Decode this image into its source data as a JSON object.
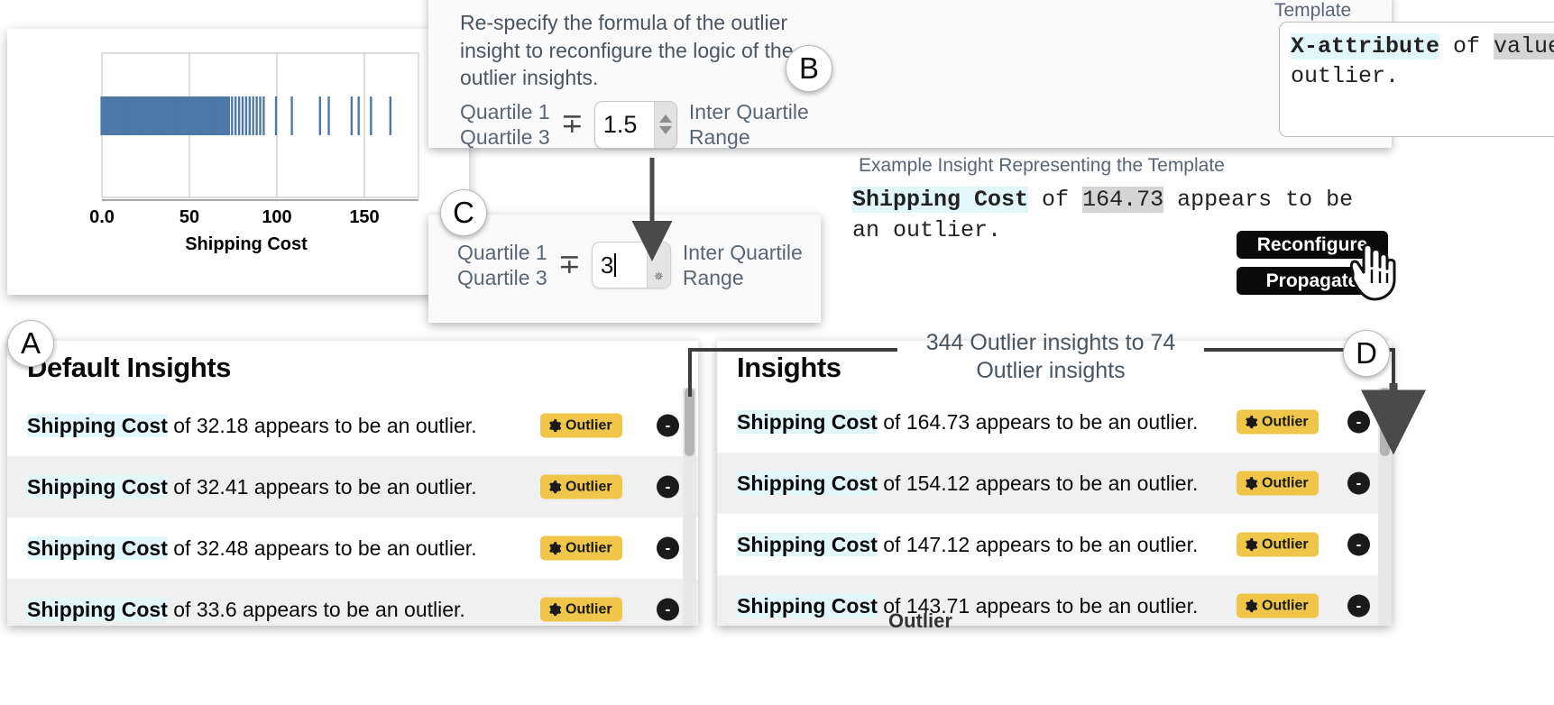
{
  "chart_panel": {
    "x_label": "Shipping Cost",
    "x_ticks": [
      "0.0",
      "50",
      "100",
      "150"
    ],
    "bar_color": "#4d79a8"
  },
  "chart_data": {
    "type": "scatter",
    "title": "",
    "xlabel": "Shipping Cost",
    "ylabel": "",
    "xlim": [
      -10,
      180
    ],
    "x_ticks": [
      0,
      50,
      100,
      150
    ],
    "x_tick_labels": [
      "0.0",
      "50",
      "100",
      "150"
    ],
    "grid": true,
    "legend": null,
    "description": "One-dimensional strip / rug plot of Shipping Cost values; dense solid band from 0 to about 72, thinning tick marks from 72 to 165.",
    "values": [
      0,
      1,
      2,
      3,
      4,
      5,
      6,
      7,
      8,
      9,
      10,
      11,
      12,
      13,
      14,
      15,
      16,
      17,
      18,
      19,
      20,
      21,
      22,
      23,
      24,
      25,
      26,
      27,
      28,
      29,
      30,
      31,
      32,
      33,
      34,
      35,
      36,
      37,
      38,
      39,
      40,
      41,
      42,
      43,
      44,
      45,
      46,
      47,
      48,
      49,
      50,
      51,
      52,
      53,
      54,
      55,
      56,
      57,
      58,
      59,
      60,
      61,
      62,
      63,
      64,
      65,
      66,
      67,
      68,
      69,
      70,
      71,
      72,
      74,
      76,
      78,
      80,
      82,
      84,
      86,
      88,
      90,
      92,
      99,
      108,
      124,
      129,
      142,
      146,
      153,
      164
    ]
  },
  "respecify": {
    "description": "Re-specify the formula of the outlier insight to reconfigure the logic of the outlier insights.",
    "quartile_1": "Quartile 1",
    "quartile_3": "Quartile 3",
    "operator": "∓",
    "multiplier_value": "1.5",
    "iqr_line_1": "Inter Quartile",
    "iqr_line_2": "Range"
  },
  "respecify_alt": {
    "quartile_1": "Quartile 1",
    "quartile_3": "Quartile 3",
    "operator": "∓",
    "multiplier_value": "3",
    "iqr_line_1": "Inter Quartile",
    "iqr_line_2": "Range"
  },
  "template_panel": {
    "label": "Template",
    "template_attr": "X-attribute",
    "template_mid": " of ",
    "template_value": "value",
    "template_tail": " appears to be an outlier.",
    "example_label": "Example Insight Representing the Template",
    "example_attr": "Shipping Cost",
    "example_mid": " of ",
    "example_value": "164.73",
    "example_tail": " appears to be an outlier.",
    "reconfigure_label": "Reconfigure",
    "propagate_label": "Propagate"
  },
  "callouts": {
    "a": "A",
    "b": "B",
    "c": "C",
    "d": "D"
  },
  "annotation": {
    "line_1": "344 Outlier insights to 74",
    "line_2": "Outlier insights"
  },
  "default_insights": {
    "title": "Default Insights",
    "badge_label": "Outlier",
    "remove_label": "-",
    "rows": [
      {
        "attr": "Shipping Cost",
        "mid": " of ",
        "value": "32.18",
        "tail": " appears to be an outlier."
      },
      {
        "attr": "Shipping Cost",
        "mid": " of ",
        "value": "32.41",
        "tail": " appears to be an outlier."
      },
      {
        "attr": "Shipping Cost",
        "mid": " of ",
        "value": "32.48",
        "tail": " appears to be an outlier."
      },
      {
        "attr": "Shipping Cost",
        "mid": " of ",
        "value": "33.6",
        "tail": " appears to be an outlier."
      }
    ]
  },
  "insights": {
    "title": "Insights",
    "badge_label": "Outlier",
    "remove_label": "-",
    "clipped_text": "Outlier",
    "rows": [
      {
        "attr": "Shipping Cost",
        "mid": " of ",
        "value": "164.73",
        "tail": " appears to be an outlier."
      },
      {
        "attr": "Shipping Cost",
        "mid": " of ",
        "value": "154.12",
        "tail": " appears to be an outlier."
      },
      {
        "attr": "Shipping Cost",
        "mid": " of ",
        "value": "147.12",
        "tail": " appears to be an outlier."
      },
      {
        "attr": "Shipping Cost",
        "mid": " of ",
        "value": "143.71",
        "tail": " appears to be an outlier."
      }
    ]
  },
  "colors": {
    "badge_yellow": "#efc64a",
    "attr_highlight": "#e2f7fa",
    "value_highlight": "#d5d5d5",
    "chart_blue": "#4d79a8",
    "button_black": "#0a0a0a"
  }
}
